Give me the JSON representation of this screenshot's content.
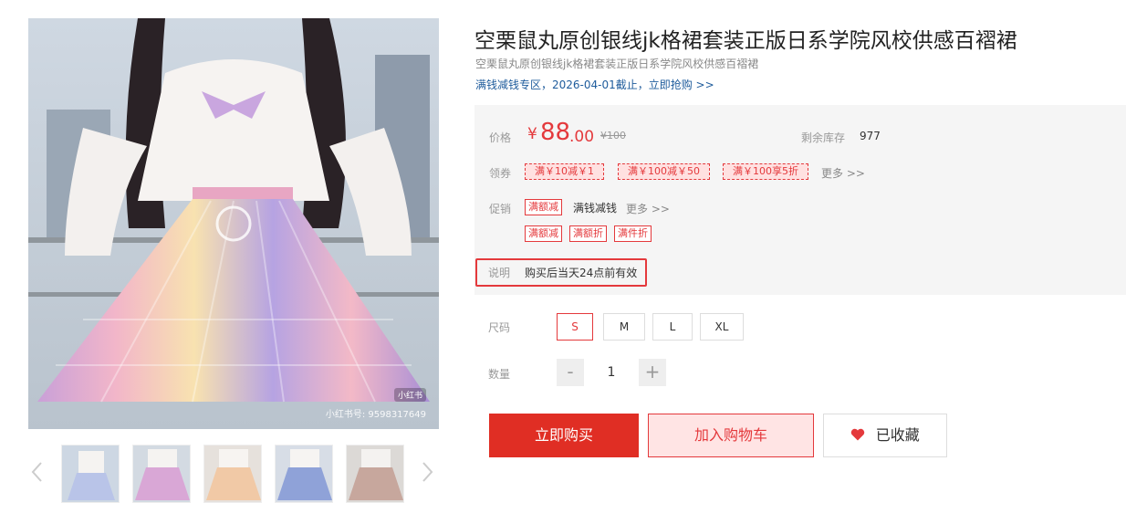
{
  "product": {
    "title": "空栗鼠丸原创银线jk格裙套装正版日系学院风校供感百褶裙",
    "subtitle": "空栗鼠丸原创银线jk格裙套装正版日系学院风校供感百褶裙",
    "promo_link": "满钱减钱专区，2026-04-01截止，立即抢购 >>"
  },
  "gallery": {
    "watermark_logo": "小红书",
    "watermark_id": "小红书号: 9598317649",
    "prev_icon": "chevron-left-icon",
    "next_icon": "chevron-right-icon",
    "thumbnails": [
      "thumb-1",
      "thumb-2",
      "thumb-3",
      "thumb-4",
      "thumb-5"
    ]
  },
  "price": {
    "label": "价格",
    "currency": "¥",
    "integer": "88",
    "decimal": ".00",
    "original": "¥100",
    "stock_label": "剩余库存",
    "stock_value": "977"
  },
  "coupons": {
    "label": "领券",
    "items": [
      "满￥10减￥1",
      "满￥100减￥50",
      "满￥100享5折"
    ],
    "more": "更多 >>"
  },
  "promotion": {
    "label": "促销",
    "main_tag": "满额减",
    "main_text": "满钱减钱",
    "more": "更多 >>",
    "tags": [
      "满额减",
      "满额折",
      "满件折"
    ]
  },
  "note": {
    "label": "说明",
    "text": "购买后当天24点前有效"
  },
  "size": {
    "label": "尺码",
    "options": [
      "S",
      "M",
      "L",
      "XL"
    ],
    "selected": "S"
  },
  "quantity": {
    "label": "数量",
    "minus": "-",
    "plus": "+",
    "value": "1"
  },
  "actions": {
    "buy": "立即购买",
    "cart": "加入购物车",
    "favorite": "已收藏",
    "favorite_icon": "heart-icon"
  },
  "colors": {
    "accent": "#e4393c",
    "buy_bg": "#e02e24",
    "cart_bg": "#ffe4e4",
    "panel_bg": "#f5f5f5",
    "link": "#1f5c9c"
  }
}
